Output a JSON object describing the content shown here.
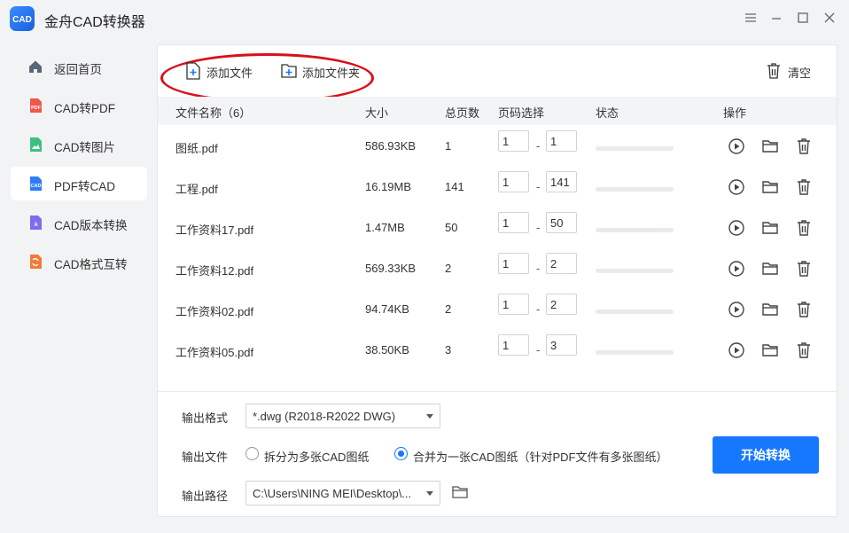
{
  "app": {
    "title": "金舟CAD转换器"
  },
  "sidebar": {
    "items": [
      {
        "label": "返回首页",
        "icon": "home-icon"
      },
      {
        "label": "CAD转PDF",
        "icon": "pdf-icon"
      },
      {
        "label": "CAD转图片",
        "icon": "image-icon"
      },
      {
        "label": "PDF转CAD",
        "icon": "cad-icon"
      },
      {
        "label": "CAD版本转换",
        "icon": "version-icon"
      },
      {
        "label": "CAD格式互转",
        "icon": "format-icon"
      }
    ],
    "active_index": 3
  },
  "toolbar": {
    "add_file": "添加文件",
    "add_folder": "添加文件夹",
    "clear": "清空"
  },
  "table": {
    "headers": {
      "name": "文件名称（6）",
      "size": "大小",
      "pages": "总页数",
      "range": "页码选择",
      "status": "状态",
      "actions": "操作"
    },
    "rows": [
      {
        "name": "图纸.pdf",
        "size": "586.93KB",
        "pages": "1",
        "from": "1",
        "to": "1",
        "progress": 0
      },
      {
        "name": "工程.pdf",
        "size": "16.19MB",
        "pages": "141",
        "from": "1",
        "to": "141",
        "progress": 0
      },
      {
        "name": "工作资料17.pdf",
        "size": "1.47MB",
        "pages": "50",
        "from": "1",
        "to": "50",
        "progress": 0
      },
      {
        "name": "工作资料12.pdf",
        "size": "569.33KB",
        "pages": "2",
        "from": "1",
        "to": "2",
        "progress": 0
      },
      {
        "name": "工作资料02.pdf",
        "size": "94.74KB",
        "pages": "2",
        "from": "1",
        "to": "2",
        "progress": 0
      },
      {
        "name": "工作资料05.pdf",
        "size": "38.50KB",
        "pages": "3",
        "from": "1",
        "to": "3",
        "progress": 0
      }
    ],
    "range_separator": "-"
  },
  "options": {
    "format_label": "输出格式",
    "format_value": "*.dwg (R2018-R2022 DWG)",
    "file_label": "输出文件",
    "split_option": "拆分为多张CAD图纸",
    "merge_option": "合并为一张CAD图纸（针对PDF文件有多张图纸）",
    "merge_selected": true,
    "path_label": "输出路径",
    "path_value": "C:\\Users\\NING MEI\\Desktop\\..."
  },
  "start_button": "开始转换",
  "colors": {
    "accent": "#1677ff",
    "highlight": "#d9101a"
  }
}
